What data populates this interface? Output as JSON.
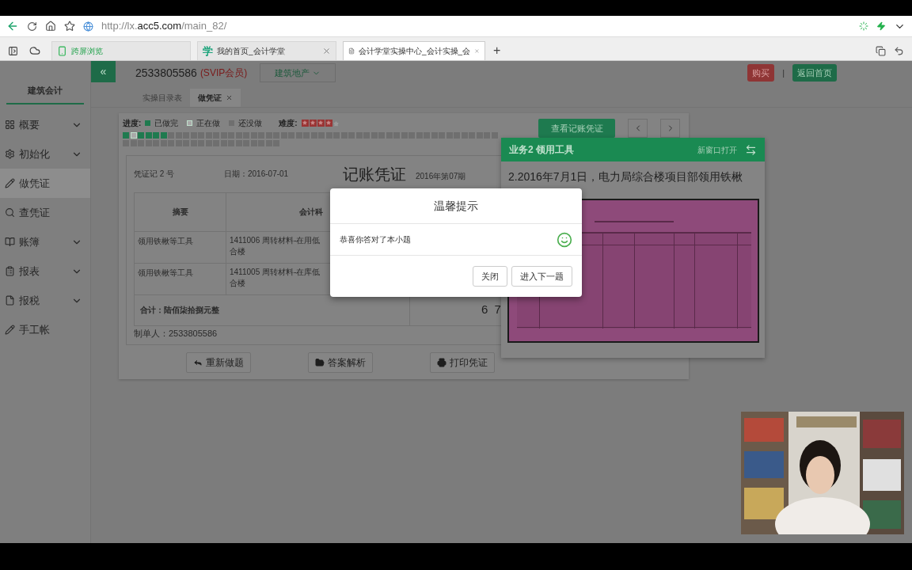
{
  "browser": {
    "url": {
      "prefix": "http://lx.",
      "domain": "acc5.com",
      "path": "/main_82/"
    },
    "tabs": [
      {
        "kind": "phone",
        "label": "跨屏浏览",
        "selected": false,
        "closable": false
      },
      {
        "kind": "logo",
        "logo": "学",
        "label": "我的首页_会计学堂",
        "selected": false,
        "closable": true
      },
      {
        "kind": "doc",
        "label": "会计学堂实操中心_会计实操_会",
        "selected": true,
        "closable": true
      }
    ],
    "new_tab": "+"
  },
  "header": {
    "collapse": "«",
    "account": "2533805586",
    "badge": "(SVIP会员)",
    "industry": "建筑地产",
    "buy": "购买",
    "divider": "|",
    "home": "返回首页"
  },
  "sidebar": {
    "title": "建筑会计",
    "items": [
      {
        "label": "概要",
        "expandable": true,
        "selected": false
      },
      {
        "label": "初始化",
        "expandable": true,
        "selected": false
      },
      {
        "label": "做凭证",
        "expandable": false,
        "selected": true
      },
      {
        "label": "查凭证",
        "expandable": false,
        "selected": false
      },
      {
        "label": "账簿",
        "expandable": true,
        "selected": false
      },
      {
        "label": "报表",
        "expandable": true,
        "selected": false
      },
      {
        "label": "报税",
        "expandable": true,
        "selected": false
      },
      {
        "label": "手工帐",
        "expandable": false,
        "selected": false
      }
    ]
  },
  "page_tabs": [
    {
      "label": "实操目录表",
      "selected": false,
      "closable": false
    },
    {
      "label": "做凭证",
      "selected": true,
      "closable": true
    }
  ],
  "progress": {
    "label": "进度:",
    "legend": [
      {
        "kind": "done",
        "label": "已做完"
      },
      {
        "kind": "current",
        "label": "正在做"
      },
      {
        "kind": "todo",
        "label": "还没做"
      }
    ],
    "difficulty_label": "难度:",
    "stars": 4,
    "questions": [
      {
        "kind": "done"
      },
      {
        "kind": "current"
      },
      {
        "kind": "done"
      },
      {
        "kind": "done"
      },
      {
        "kind": "done"
      },
      {
        "kind": "done"
      },
      {
        "kind": "todo"
      },
      {
        "kind": "todo"
      },
      {
        "kind": "todo"
      },
      {
        "kind": "todo"
      },
      {
        "kind": "todo"
      },
      {
        "kind": "todo"
      },
      {
        "kind": "todo"
      },
      {
        "kind": "todo"
      },
      {
        "kind": "todo"
      },
      {
        "kind": "todo"
      },
      {
        "kind": "todo"
      },
      {
        "kind": "todo"
      },
      {
        "kind": "todo"
      },
      {
        "kind": "todo"
      },
      {
        "kind": "todo"
      },
      {
        "kind": "todo"
      },
      {
        "kind": "todo"
      },
      {
        "kind": "todo"
      },
      {
        "kind": "todo"
      },
      {
        "kind": "todo"
      },
      {
        "kind": "todo"
      },
      {
        "kind": "todo"
      },
      {
        "kind": "todo"
      },
      {
        "kind": "todo"
      },
      {
        "kind": "todo"
      },
      {
        "kind": "todo"
      },
      {
        "kind": "todo"
      },
      {
        "kind": "todo"
      },
      {
        "kind": "todo"
      },
      {
        "kind": "todo"
      },
      {
        "kind": "todo"
      },
      {
        "kind": "todo"
      },
      {
        "kind": "todo"
      },
      {
        "kind": "todo"
      },
      {
        "kind": "todo"
      },
      {
        "kind": "todo"
      },
      {
        "kind": "todo"
      },
      {
        "kind": "todo"
      },
      {
        "kind": "todo"
      },
      {
        "kind": "todo"
      },
      {
        "kind": "todo"
      },
      {
        "kind": "todo"
      },
      {
        "kind": "todo"
      },
      {
        "kind": "todo"
      },
      {
        "kind": "todo"
      },
      {
        "kind": "todo"
      },
      {
        "kind": "todo"
      },
      {
        "kind": "todo"
      },
      {
        "kind": "todo"
      },
      {
        "kind": "todo"
      },
      {
        "kind": "todo"
      },
      {
        "kind": "todo"
      },
      {
        "kind": "todo"
      },
      {
        "kind": "todo"
      },
      {
        "kind": "todo"
      },
      {
        "kind": "todo"
      },
      {
        "kind": "todo"
      },
      {
        "kind": "todo"
      },
      {
        "kind": "todo"
      },
      {
        "kind": "todo"
      },
      {
        "kind": "todo"
      },
      {
        "kind": "todo"
      },
      {
        "kind": "todo"
      },
      {
        "kind": "todo"
      },
      {
        "kind": "todo"
      }
    ]
  },
  "view_voucher_button": "查看记账凭证",
  "voucher": {
    "number": "凭证记 2 号",
    "date": "日期：2016-07-01",
    "title": "记账凭证",
    "period": "2016年第07期",
    "columns": [
      "摘要",
      "会计科"
    ],
    "rows": [
      {
        "summary": "领用铁楸等工具",
        "account_lines": [
          "1411006 周转材料-在用低",
          "合楼"
        ]
      },
      {
        "summary": "领用铁楸等工具",
        "account_lines": [
          "1411005 周转材料-在库低",
          "合楼"
        ]
      }
    ],
    "total_label": "合计：陆佰柒拾捌元整",
    "total_amount": "6 7",
    "maker": "制单人：2533805586"
  },
  "actions": [
    {
      "label": "重新做题"
    },
    {
      "label": "答案解析"
    },
    {
      "label": "打印凭证"
    }
  ],
  "task_panel": {
    "title": "业务2 领用工具",
    "open_new": "新窗口打开",
    "text": "2.2016年7月1日，电力局综合楼项目部领用铁楸"
  },
  "dialog": {
    "title": "温馨提示",
    "message": "恭喜你答对了本小题",
    "buttons": [
      "关闭",
      "进入下一题"
    ]
  }
}
